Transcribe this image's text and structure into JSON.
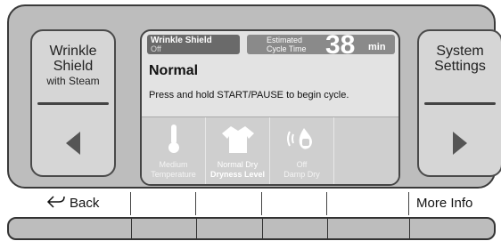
{
  "left_panel": {
    "line1": "Wrinkle",
    "line2": "Shield",
    "line3": "with Steam",
    "arrow_icon": "left-triangle-icon"
  },
  "right_panel": {
    "line1": "System",
    "line2": "Settings",
    "arrow_icon": "right-triangle-icon"
  },
  "screen": {
    "wrinkle_shield": {
      "title": "Wrinkle Shield",
      "value": "Off"
    },
    "estimated": {
      "line1": "Estimated",
      "line2": "Cycle Time",
      "minutes": "38",
      "unit": "min"
    },
    "cycle_name": "Normal",
    "instruction": "Press and hold START/PAUSE to begin cycle.",
    "options": [
      {
        "icon": "thermometer-icon",
        "value": "Medium",
        "name": "Temperature"
      },
      {
        "icon": "shirt-icon",
        "value": "Normal Dry",
        "name": "Dryness Level"
      },
      {
        "icon": "damp-dry-icon",
        "value": "Off",
        "name": "Damp Dry"
      }
    ]
  },
  "buttons": {
    "back": "Back",
    "more_info": "More Info"
  },
  "colors": {
    "bezel": "#bdbdbd",
    "screen": "#e3e3e3",
    "options_bg": "#cfcfcf"
  }
}
